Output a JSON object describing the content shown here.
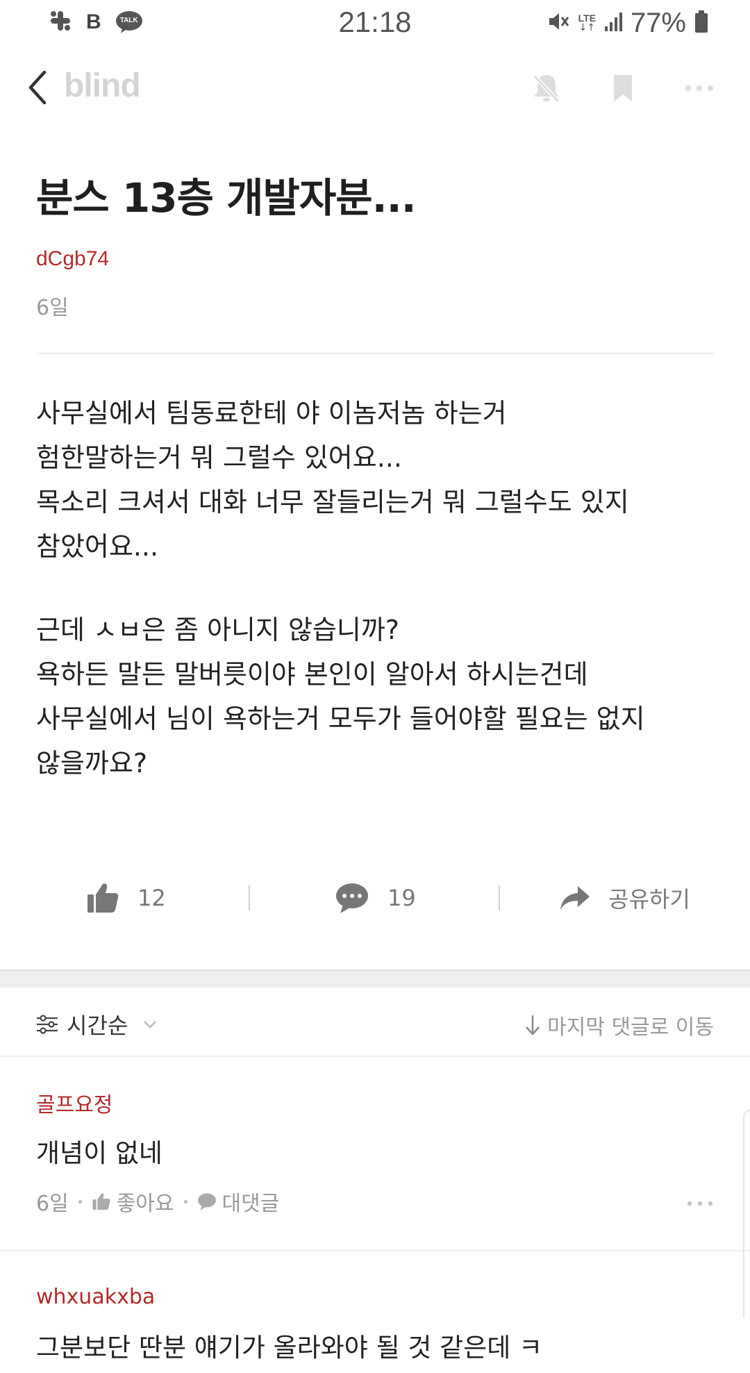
{
  "status_bar": {
    "time": "21:18",
    "battery": "77%",
    "left_icons": [
      "slack-icon",
      "b-app-icon",
      "kakaotalk-icon"
    ],
    "talk_label": "TALK",
    "b_label": "B",
    "network": "LTE",
    "right_icons": [
      "mute-icon",
      "lte-icon",
      "signal-icon",
      "battery-icon"
    ]
  },
  "app_bar": {
    "logo": "blind",
    "icons": [
      "back-icon",
      "notification-off-icon",
      "bookmark-icon",
      "more-icon"
    ]
  },
  "post": {
    "title": "분스 13층 개발자분...",
    "author": "dCgb74",
    "time": "6일",
    "body_lines": [
      "사무실에서 팀동료한테 야 이놈저놈 하는거",
      "험한말하는거 뭐 그럴수 있어요...",
      "목소리 크셔서 대화 너무 잘들리는거 뭐 그럴수도 있지",
      "참았어요...",
      "",
      "근데 ㅅㅂ은 좀 아니지 않습니까?",
      "욕하든 말든 말버릇이야 본인이 알아서 하시는건데",
      "사무실에서 님이 욕하는거 모두가 들어야할 필요는 없지",
      "않을까요?"
    ]
  },
  "actions": {
    "likes": "12",
    "comments": "19",
    "share_label": "공유하기"
  },
  "sort_bar": {
    "sort_label": "시간순",
    "jump_label": "마지막 댓글로 이동"
  },
  "comments": [
    {
      "author": "골프요정",
      "text": "개념이 없네",
      "time": "6일",
      "like_label": "좋아요",
      "reply_label": "대댓글"
    },
    {
      "author": "whxuakxba",
      "text": "그분보단 딴분 얘기가 올라와야 될 것 같은데 ㅋ"
    }
  ],
  "colors": {
    "author": "#b22a2a",
    "muted": "#999999",
    "logo": "#d4d4d4"
  }
}
